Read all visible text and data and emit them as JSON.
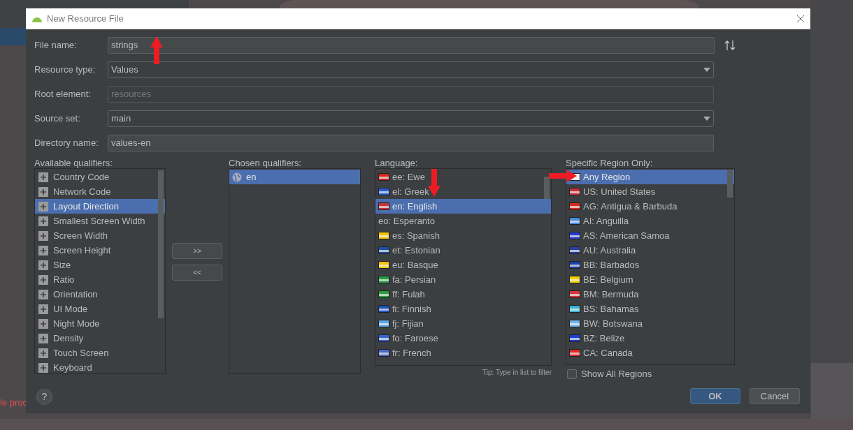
{
  "background": {
    "text": "le proc"
  },
  "window": {
    "title": "New Resource File"
  },
  "form": [
    {
      "label": "File name:",
      "kind": "text",
      "value": "strings"
    },
    {
      "label": "Resource type:",
      "kind": "dropdown",
      "value": "Values"
    },
    {
      "label": "Root element:",
      "kind": "text",
      "placeholder": "resources"
    },
    {
      "label": "Source set:",
      "kind": "dropdown",
      "value": "main"
    },
    {
      "label": "Directory name:",
      "kind": "text",
      "value": "values-en"
    }
  ],
  "available_qualifiers": {
    "label": "Available qualifiers:",
    "items": [
      {
        "label": "Country Code",
        "selected": false
      },
      {
        "label": "Network Code",
        "selected": false
      },
      {
        "label": "Layout Direction",
        "selected": true
      },
      {
        "label": "Smallest Screen Width",
        "selected": false
      },
      {
        "label": "Screen Width",
        "selected": false
      },
      {
        "label": "Screen Height",
        "selected": false
      },
      {
        "label": "Size",
        "selected": false
      },
      {
        "label": "Ratio",
        "selected": false
      },
      {
        "label": "Orientation",
        "selected": false
      },
      {
        "label": "UI Mode",
        "selected": false
      },
      {
        "label": "Night Mode",
        "selected": false
      },
      {
        "label": "Density",
        "selected": false
      },
      {
        "label": "Touch Screen",
        "selected": false
      },
      {
        "label": "Keyboard",
        "selected": false
      }
    ]
  },
  "move_buttons": [
    ">>",
    "<<"
  ],
  "chosen_qualifiers": {
    "label": "Chosen qualifiers:",
    "items": [
      {
        "label": "en",
        "selected": true
      }
    ]
  },
  "language": {
    "label": "Language:",
    "tip": "Tip: Type in list to filter",
    "items": [
      {
        "label": "ee: Ewe",
        "selected": false,
        "color": "#d7261e"
      },
      {
        "label": "el: Greek",
        "selected": false,
        "color": "#2a5fd4"
      },
      {
        "label": "en: English",
        "selected": true,
        "color": "#c8323c"
      },
      {
        "label": "eo: Esperanto",
        "selected": false
      },
      {
        "label": "es: Spanish",
        "selected": false,
        "color": "#f2c200"
      },
      {
        "label": "et: Estonian",
        "selected": false,
        "color": "#1f4fa8"
      },
      {
        "label": "eu: Basque",
        "selected": false,
        "color": "#f2c200"
      },
      {
        "label": "fa: Persian",
        "selected": false,
        "color": "#239f40"
      },
      {
        "label": "ff: Fulah",
        "selected": false,
        "color": "#2e9c3c"
      },
      {
        "label": "fi: Finnish",
        "selected": false,
        "color": "#1d4fc0"
      },
      {
        "label": "fj: Fijian",
        "selected": false,
        "color": "#5aa8e8"
      },
      {
        "label": "fo: Faroese",
        "selected": false,
        "color": "#3a64d0"
      },
      {
        "label": "fr: French",
        "selected": false,
        "color": "#4a66c8"
      }
    ]
  },
  "region": {
    "label": "Specific Region Only:",
    "items": [
      {
        "label": "Any Region",
        "selected": true,
        "color": "#eeeeee"
      },
      {
        "label": "US: United States",
        "selected": false,
        "color": "#c8323c"
      },
      {
        "label": "AG: Antigua & Barbuda",
        "selected": false,
        "color": "#d52b1e"
      },
      {
        "label": "AI: Anguilla",
        "selected": false,
        "color": "#4a8ae0"
      },
      {
        "label": "AS: American Samoa",
        "selected": false,
        "color": "#2a3ccf"
      },
      {
        "label": "AU: Australia",
        "selected": false,
        "color": "#2b3f9e"
      },
      {
        "label": "BB: Barbados",
        "selected": false,
        "color": "#1e3fb0"
      },
      {
        "label": "BE: Belgium",
        "selected": false,
        "color": "#f5d000"
      },
      {
        "label": "BM: Bermuda",
        "selected": false,
        "color": "#d8343c"
      },
      {
        "label": "BS: Bahamas",
        "selected": false,
        "color": "#3ab4d0"
      },
      {
        "label": "BW: Botswana",
        "selected": false,
        "color": "#74b6e6"
      },
      {
        "label": "BZ: Belize",
        "selected": false,
        "color": "#1f3fd0"
      },
      {
        "label": "CA: Canada",
        "selected": false,
        "color": "#e02828"
      }
    ],
    "show_all": {
      "label": "Show All Regions",
      "checked": false
    }
  },
  "help": "?",
  "buttons": [
    {
      "label": "OK",
      "kind": "primary"
    },
    {
      "label": "Cancel",
      "kind": "secondary"
    }
  ]
}
